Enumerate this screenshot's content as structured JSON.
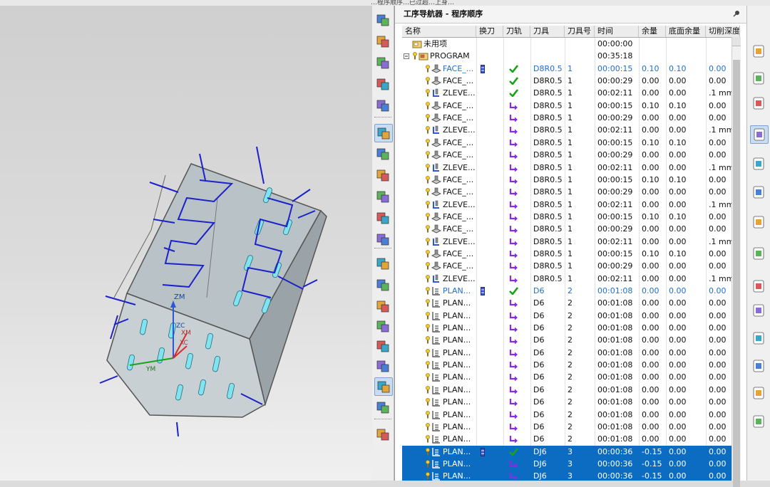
{
  "window": {
    "title_fragment": "…程序顺序…已过超…上身…"
  },
  "navigator": {
    "title": "工序导航器 - 程序顺序",
    "columns": [
      "名称",
      "换刀",
      "刀轨",
      "刀具",
      "刀具号",
      "时间",
      "余量",
      "底面余量",
      "切削深度"
    ],
    "rows": [
      {
        "name": "未用项",
        "level": 0,
        "kind": "folder",
        "tc": "",
        "path": "",
        "tool": "",
        "num": "",
        "time": "00:00:00",
        "stock": "",
        "floor": "",
        "depth": "",
        "blue": false,
        "sel": false
      },
      {
        "name": "PROGRAM",
        "level": 0,
        "kind": "program",
        "tc": "",
        "path": "",
        "tool": "",
        "num": "",
        "time": "00:35:18",
        "stock": "",
        "floor": "",
        "depth": "",
        "blue": false,
        "sel": false
      },
      {
        "name": "FACE_...",
        "level": 1,
        "kind": "face",
        "tc": "bar",
        "path": "check",
        "tool": "D8R0.5",
        "num": "1",
        "time": "00:00:15",
        "stock": "0.10",
        "floor": "0.10",
        "depth": "0.00",
        "blue": true,
        "sel": false
      },
      {
        "name": "FACE_...",
        "level": 1,
        "kind": "face",
        "tc": "",
        "path": "check",
        "tool": "D8R0.5",
        "num": "1",
        "time": "00:00:29",
        "stock": "0.00",
        "floor": "0.00",
        "depth": "0.00",
        "blue": false,
        "sel": false
      },
      {
        "name": "ZLEVE...",
        "level": 1,
        "kind": "zlevel",
        "tc": "",
        "path": "check",
        "tool": "D8R0.5",
        "num": "1",
        "time": "00:02:11",
        "stock": "0.00",
        "floor": "0.00",
        "depth": ".1 mm",
        "blue": false,
        "sel": false
      },
      {
        "name": "FACE_...",
        "level": 1,
        "kind": "face",
        "tc": "",
        "path": "arrow",
        "tool": "D8R0.5",
        "num": "1",
        "time": "00:00:15",
        "stock": "0.10",
        "floor": "0.10",
        "depth": "0.00",
        "blue": false,
        "sel": false
      },
      {
        "name": "FACE_...",
        "level": 1,
        "kind": "face",
        "tc": "",
        "path": "arrow",
        "tool": "D8R0.5",
        "num": "1",
        "time": "00:00:29",
        "stock": "0.00",
        "floor": "0.00",
        "depth": "0.00",
        "blue": false,
        "sel": false
      },
      {
        "name": "ZLEVE...",
        "level": 1,
        "kind": "zlevel",
        "tc": "",
        "path": "arrow",
        "tool": "D8R0.5",
        "num": "1",
        "time": "00:02:11",
        "stock": "0.00",
        "floor": "0.00",
        "depth": ".1 mm",
        "blue": false,
        "sel": false
      },
      {
        "name": "FACE_...",
        "level": 1,
        "kind": "face",
        "tc": "",
        "path": "arrow",
        "tool": "D8R0.5",
        "num": "1",
        "time": "00:00:15",
        "stock": "0.10",
        "floor": "0.10",
        "depth": "0.00",
        "blue": false,
        "sel": false
      },
      {
        "name": "FACE_...",
        "level": 1,
        "kind": "face",
        "tc": "",
        "path": "arrow",
        "tool": "D8R0.5",
        "num": "1",
        "time": "00:00:29",
        "stock": "0.00",
        "floor": "0.00",
        "depth": "0.00",
        "blue": false,
        "sel": false
      },
      {
        "name": "ZLEVE...",
        "level": 1,
        "kind": "zlevel",
        "tc": "",
        "path": "arrow",
        "tool": "D8R0.5",
        "num": "1",
        "time": "00:02:11",
        "stock": "0.00",
        "floor": "0.00",
        "depth": ".1 mm",
        "blue": false,
        "sel": false
      },
      {
        "name": "FACE_...",
        "level": 1,
        "kind": "face",
        "tc": "",
        "path": "arrow",
        "tool": "D8R0.5",
        "num": "1",
        "time": "00:00:15",
        "stock": "0.10",
        "floor": "0.10",
        "depth": "0.00",
        "blue": false,
        "sel": false
      },
      {
        "name": "FACE_...",
        "level": 1,
        "kind": "face",
        "tc": "",
        "path": "arrow",
        "tool": "D8R0.5",
        "num": "1",
        "time": "00:00:29",
        "stock": "0.00",
        "floor": "0.00",
        "depth": "0.00",
        "blue": false,
        "sel": false
      },
      {
        "name": "ZLEVE...",
        "level": 1,
        "kind": "zlevel",
        "tc": "",
        "path": "arrow",
        "tool": "D8R0.5",
        "num": "1",
        "time": "00:02:11",
        "stock": "0.00",
        "floor": "0.00",
        "depth": ".1 mm",
        "blue": false,
        "sel": false
      },
      {
        "name": "FACE_...",
        "level": 1,
        "kind": "face",
        "tc": "",
        "path": "arrow",
        "tool": "D8R0.5",
        "num": "1",
        "time": "00:00:15",
        "stock": "0.10",
        "floor": "0.10",
        "depth": "0.00",
        "blue": false,
        "sel": false
      },
      {
        "name": "FACE_...",
        "level": 1,
        "kind": "face",
        "tc": "",
        "path": "arrow",
        "tool": "D8R0.5",
        "num": "1",
        "time": "00:00:29",
        "stock": "0.00",
        "floor": "0.00",
        "depth": "0.00",
        "blue": false,
        "sel": false
      },
      {
        "name": "ZLEVE...",
        "level": 1,
        "kind": "zlevel",
        "tc": "",
        "path": "arrow",
        "tool": "D8R0.5",
        "num": "1",
        "time": "00:02:11",
        "stock": "0.00",
        "floor": "0.00",
        "depth": ".1 mm",
        "blue": false,
        "sel": false
      },
      {
        "name": "FACE_...",
        "level": 1,
        "kind": "face",
        "tc": "",
        "path": "arrow",
        "tool": "D8R0.5",
        "num": "1",
        "time": "00:00:15",
        "stock": "0.10",
        "floor": "0.10",
        "depth": "0.00",
        "blue": false,
        "sel": false
      },
      {
        "name": "FACE_...",
        "level": 1,
        "kind": "face",
        "tc": "",
        "path": "arrow",
        "tool": "D8R0.5",
        "num": "1",
        "time": "00:00:29",
        "stock": "0.00",
        "floor": "0.00",
        "depth": "0.00",
        "blue": false,
        "sel": false
      },
      {
        "name": "ZLEVE...",
        "level": 1,
        "kind": "zlevel",
        "tc": "",
        "path": "arrow",
        "tool": "D8R0.5",
        "num": "1",
        "time": "00:02:11",
        "stock": "0.00",
        "floor": "0.00",
        "depth": ".1 mm",
        "blue": false,
        "sel": false
      },
      {
        "name": "PLAN...",
        "level": 1,
        "kind": "plan",
        "tc": "bar",
        "path": "check",
        "tool": "D6",
        "num": "2",
        "time": "00:01:08",
        "stock": "0.00",
        "floor": "0.00",
        "depth": "0.00",
        "blue": true,
        "sel": false
      },
      {
        "name": "PLAN...",
        "level": 1,
        "kind": "plan",
        "tc": "",
        "path": "arrow",
        "tool": "D6",
        "num": "2",
        "time": "00:01:08",
        "stock": "0.00",
        "floor": "0.00",
        "depth": "0.00",
        "blue": false,
        "sel": false
      },
      {
        "name": "PLAN...",
        "level": 1,
        "kind": "plan",
        "tc": "",
        "path": "arrow",
        "tool": "D6",
        "num": "2",
        "time": "00:01:08",
        "stock": "0.00",
        "floor": "0.00",
        "depth": "0.00",
        "blue": false,
        "sel": false
      },
      {
        "name": "PLAN...",
        "level": 1,
        "kind": "plan",
        "tc": "",
        "path": "arrow",
        "tool": "D6",
        "num": "2",
        "time": "00:01:08",
        "stock": "0.00",
        "floor": "0.00",
        "depth": "0.00",
        "blue": false,
        "sel": false
      },
      {
        "name": "PLAN...",
        "level": 1,
        "kind": "plan",
        "tc": "",
        "path": "arrow",
        "tool": "D6",
        "num": "2",
        "time": "00:01:08",
        "stock": "0.00",
        "floor": "0.00",
        "depth": "0.00",
        "blue": false,
        "sel": false
      },
      {
        "name": "PLAN...",
        "level": 1,
        "kind": "plan",
        "tc": "",
        "path": "arrow",
        "tool": "D6",
        "num": "2",
        "time": "00:01:08",
        "stock": "0.00",
        "floor": "0.00",
        "depth": "0.00",
        "blue": false,
        "sel": false
      },
      {
        "name": "PLAN...",
        "level": 1,
        "kind": "plan",
        "tc": "",
        "path": "arrow",
        "tool": "D6",
        "num": "2",
        "time": "00:01:08",
        "stock": "0.00",
        "floor": "0.00",
        "depth": "0.00",
        "blue": false,
        "sel": false
      },
      {
        "name": "PLAN...",
        "level": 1,
        "kind": "plan",
        "tc": "",
        "path": "arrow",
        "tool": "D6",
        "num": "2",
        "time": "00:01:08",
        "stock": "0.00",
        "floor": "0.00",
        "depth": "0.00",
        "blue": false,
        "sel": false
      },
      {
        "name": "PLAN...",
        "level": 1,
        "kind": "plan",
        "tc": "",
        "path": "arrow",
        "tool": "D6",
        "num": "2",
        "time": "00:01:08",
        "stock": "0.00",
        "floor": "0.00",
        "depth": "0.00",
        "blue": false,
        "sel": false
      },
      {
        "name": "PLAN...",
        "level": 1,
        "kind": "plan",
        "tc": "",
        "path": "arrow",
        "tool": "D6",
        "num": "2",
        "time": "00:01:08",
        "stock": "0.00",
        "floor": "0.00",
        "depth": "0.00",
        "blue": false,
        "sel": false
      },
      {
        "name": "PLAN...",
        "level": 1,
        "kind": "plan",
        "tc": "",
        "path": "arrow",
        "tool": "D6",
        "num": "2",
        "time": "00:01:08",
        "stock": "0.00",
        "floor": "0.00",
        "depth": "0.00",
        "blue": false,
        "sel": false
      },
      {
        "name": "PLAN...",
        "level": 1,
        "kind": "plan",
        "tc": "",
        "path": "arrow",
        "tool": "D6",
        "num": "2",
        "time": "00:01:08",
        "stock": "0.00",
        "floor": "0.00",
        "depth": "0.00",
        "blue": false,
        "sel": false
      },
      {
        "name": "PLAN...",
        "level": 1,
        "kind": "plan",
        "tc": "",
        "path": "arrow",
        "tool": "D6",
        "num": "2",
        "time": "00:01:08",
        "stock": "0.00",
        "floor": "0.00",
        "depth": "0.00",
        "blue": false,
        "sel": false
      },
      {
        "name": "PLAN...",
        "level": 1,
        "kind": "plan",
        "tc": "bar",
        "path": "check",
        "tool": "DJ6",
        "num": "3",
        "time": "00:00:36",
        "stock": "-0.15",
        "floor": "0.00",
        "depth": "0.00",
        "blue": false,
        "sel": true
      },
      {
        "name": "PLAN...",
        "level": 1,
        "kind": "plan",
        "tc": "",
        "path": "arrow",
        "tool": "DJ6",
        "num": "3",
        "time": "00:00:36",
        "stock": "-0.15",
        "floor": "0.00",
        "depth": "0.00",
        "blue": false,
        "sel": true
      },
      {
        "name": "PLAN...",
        "level": 1,
        "kind": "plan",
        "tc": "",
        "path": "arrow",
        "tool": "DJ6",
        "num": "3",
        "time": "00:00:36",
        "stock": "-0.15",
        "floor": "0.00",
        "depth": "0.00",
        "blue": false,
        "sel": true
      },
      {
        "name": "PLAN...",
        "level": 1,
        "kind": "plan",
        "tc": "",
        "path": "arrow",
        "tool": "DJ6",
        "num": "3",
        "time": "00:00:36",
        "stock": "-0.15",
        "floor": "0.00",
        "depth": "0.00",
        "blue": false,
        "sel": true
      }
    ]
  },
  "viewport": {
    "axis_labels": {
      "z": "ZM",
      "y": "YM",
      "zc": "ZC",
      "xc": "XC",
      "xm": "XM"
    }
  },
  "icons": {
    "left_toolbar": [
      "create-program-icon",
      "create-tool-icon",
      "create-geometry-icon",
      "create-method-icon",
      "create-operation-icon",
      "program-order-view-icon",
      "machine-tool-view-icon",
      "geometry-view-icon",
      "method-view-icon",
      "generate-toolpath-icon",
      "replay-toolpath-icon",
      "edit-operation-icon",
      "cut-icon",
      "copy-icon",
      "paste-icon",
      "delete-icon",
      "verify-toolpath-icon",
      "simulate-icon",
      "post-process-icon",
      "shop-doc-icon",
      "output-cls-icon"
    ],
    "right_toolbar": [
      "resource-bar-icon",
      "assembly-nav-icon",
      "part-nav-icon",
      "operation-nav-icon",
      "reuse-library-icon",
      "web-browser-icon",
      "history-icon",
      "info-icon",
      "process-doc-icon",
      "clock-icon",
      "report-icon",
      "color-icon",
      "machine-icon",
      "roles-icon",
      "print-icon"
    ]
  },
  "colors": {
    "selection": "#0b6cc2",
    "highlight_text": "#1f6fc9",
    "check": "#1aa31a",
    "arrow": "#8a2be2",
    "toolpath": "#1c21c9"
  }
}
